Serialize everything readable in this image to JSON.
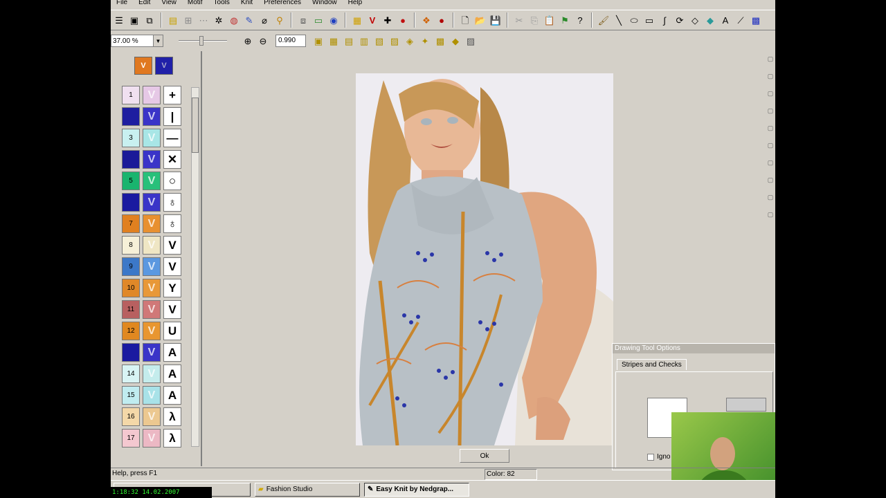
{
  "menu": [
    "File",
    "Edit",
    "View",
    "Motif",
    "Tools",
    "Knit",
    "Preferences",
    "Window",
    "Help"
  ],
  "toolbar": {
    "zoom_percent": "37.00 %",
    "value_box": "0.990"
  },
  "palette": {
    "rows": [
      {
        "num": "1",
        "color": "#f0e0f0",
        "vcolor": "#e6c8e6",
        "symbol": "+"
      },
      {
        "num": "",
        "color": "#1e1ea0",
        "vcolor": "#3a34c8",
        "symbol": "|"
      },
      {
        "num": "3",
        "color": "#c8f0f0",
        "vcolor": "#a8e6e6",
        "symbol": "—"
      },
      {
        "num": "",
        "color": "#1a1a98",
        "vcolor": "#3a34c8",
        "symbol": "✕"
      },
      {
        "num": "5",
        "color": "#19b46e",
        "vcolor": "#28c07a",
        "symbol": "○"
      },
      {
        "num": "",
        "color": "#1a1aa0",
        "vcolor": "#3a34c8",
        "symbol": "♁"
      },
      {
        "num": "7",
        "color": "#e08020",
        "vcolor": "#e89030",
        "symbol": "♁"
      },
      {
        "num": "8",
        "color": "#f6f0d8",
        "vcolor": "#efe6c4",
        "symbol": "V"
      },
      {
        "num": "9",
        "color": "#3c78c8",
        "vcolor": "#5a98e0",
        "symbol": "V"
      },
      {
        "num": "10",
        "color": "#e08828",
        "vcolor": "#e89838",
        "symbol": "Y"
      },
      {
        "num": "11",
        "color": "#b86060",
        "vcolor": "#d07878",
        "symbol": "V"
      },
      {
        "num": "12",
        "color": "#e08820",
        "vcolor": "#e89630",
        "symbol": "U"
      },
      {
        "num": "",
        "color": "#1a1aa0",
        "vcolor": "#3a34c8",
        "symbol": "A"
      },
      {
        "num": "14",
        "color": "#d8f4f4",
        "vcolor": "#c4ecec",
        "symbol": "A"
      },
      {
        "num": "15",
        "color": "#c0ecf0",
        "vcolor": "#a8e2e8",
        "symbol": "A"
      },
      {
        "num": "16",
        "color": "#f4d8a8",
        "vcolor": "#ecc890",
        "symbol": "λ"
      },
      {
        "num": "17",
        "color": "#f4c8d0",
        "vcolor": "#ecb8c4",
        "symbol": "λ"
      }
    ]
  },
  "ok_button": "Ok",
  "drawing_tool_options": {
    "title": "Drawing Tool Options",
    "tab": "Stripes and Checks",
    "checkbox_label": "Igno"
  },
  "status": {
    "help": "Help, press F1",
    "color": "Color: 82"
  },
  "taskbar": {
    "clock": "1:18:32 14.02.2007",
    "tasks": [
      "Fashion Studio",
      "Easy Knit by Nedgrap..."
    ]
  }
}
